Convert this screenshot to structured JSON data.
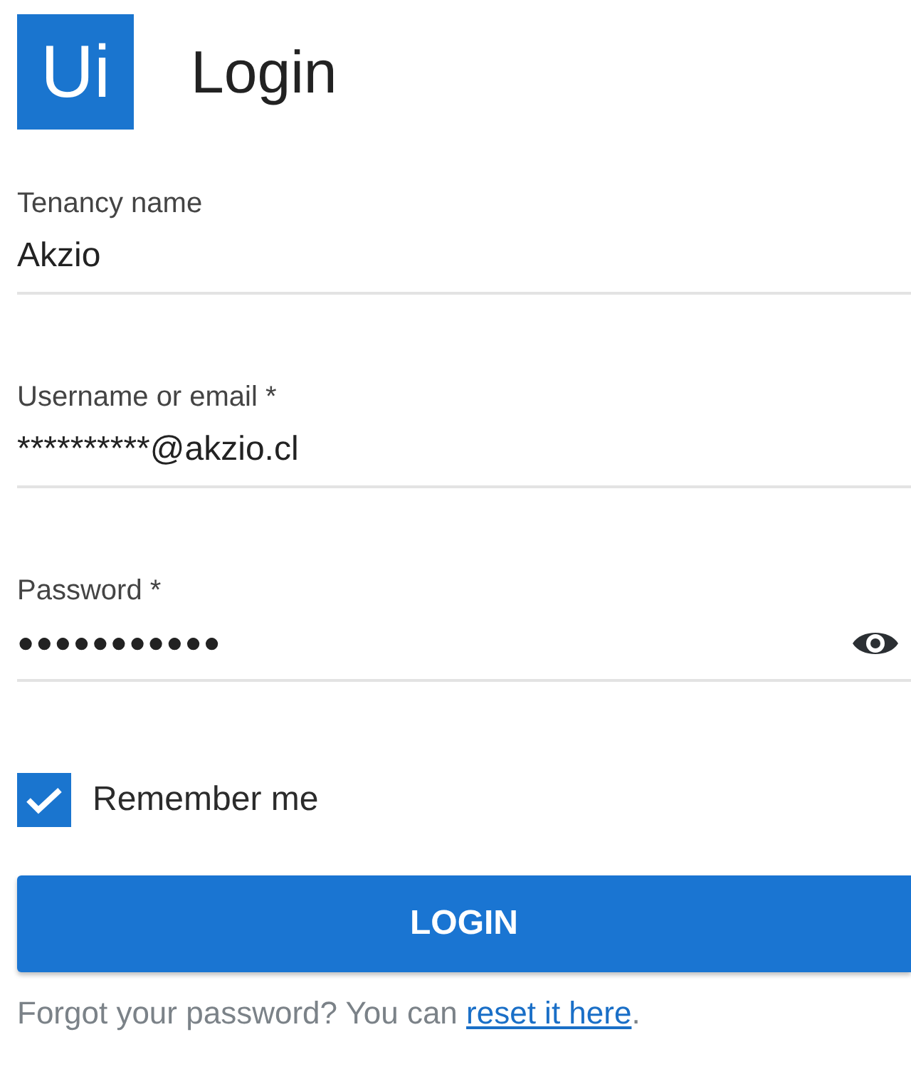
{
  "header": {
    "logo": "Ui",
    "title": "Login"
  },
  "fields": [
    {
      "kind": "text",
      "label": "Tenancy name",
      "value": "Akzio"
    },
    {
      "kind": "text",
      "label": "Username or email *",
      "value": "**********@akzio.cl"
    },
    {
      "kind": "password",
      "label": "Password *",
      "value": "●●●●●●●●●●●"
    }
  ],
  "remember": {
    "label": "Remember me",
    "checked": true
  },
  "button": "LOGIN",
  "footer": {
    "text": "Forgot your password? You can ",
    "link": "reset it here",
    "after": "."
  }
}
